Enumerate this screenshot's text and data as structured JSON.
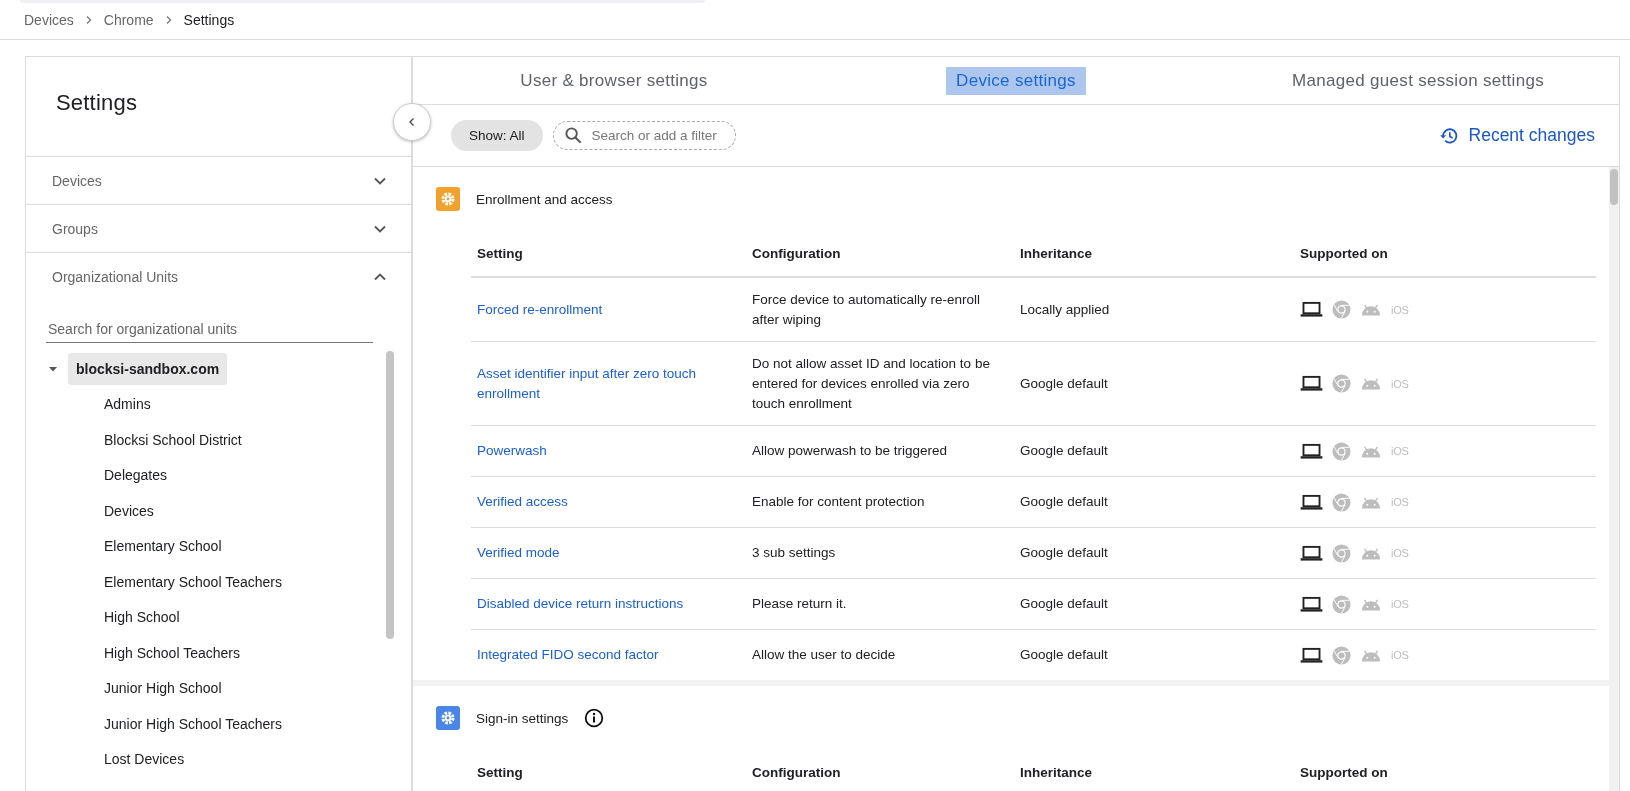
{
  "breadcrumb": [
    {
      "label": "Devices",
      "current": false
    },
    {
      "label": "Chrome",
      "current": false
    },
    {
      "label": "Settings",
      "current": true
    }
  ],
  "sidebar": {
    "title": "Settings",
    "sections": [
      {
        "label": "Devices",
        "expanded": false
      },
      {
        "label": "Groups",
        "expanded": false
      },
      {
        "label": "Organizational Units",
        "expanded": true
      }
    ],
    "search": {
      "placeholder": "Search for organizational units"
    },
    "tree": [
      {
        "label": "blocksi-sandbox.com",
        "selected": true,
        "expanded": true,
        "children": [
          {
            "label": "Admins",
            "selected": false
          },
          {
            "label": "Blocksi School District",
            "selected": false
          },
          {
            "label": "Delegates",
            "selected": false
          },
          {
            "label": "Devices",
            "selected": false
          },
          {
            "label": "Elementary School",
            "selected": false
          },
          {
            "label": "Elementary School Teachers",
            "selected": false
          },
          {
            "label": "High School",
            "selected": false
          },
          {
            "label": "High School Teachers",
            "selected": false
          },
          {
            "label": "Junior High School",
            "selected": false
          },
          {
            "label": "Junior High School Teachers",
            "selected": false
          },
          {
            "label": "Lost Devices",
            "selected": false
          }
        ]
      }
    ]
  },
  "tabs": [
    {
      "label": "User & browser settings",
      "selected": false
    },
    {
      "label": "Device settings",
      "selected": true
    },
    {
      "label": "Managed guest session settings",
      "selected": false
    }
  ],
  "toolbar": {
    "show_filter": "Show: All",
    "search": {
      "placeholder": "Search or add a filter"
    },
    "recent_changes": "Recent changes"
  },
  "sections": [
    {
      "title": "Enrollment and access",
      "color": "#f2a12e",
      "columns": [
        "Setting",
        "Configuration",
        "Inheritance",
        "Supported on"
      ],
      "rows": [
        {
          "setting": "Forced re-enrollment",
          "configuration": "Force device to automatically re-enroll after wiping",
          "inheritance": "Locally applied",
          "platforms": [
            {
              "kind": "laptop",
              "supported": true
            },
            {
              "kind": "chrome",
              "supported": false
            },
            {
              "kind": "android",
              "supported": false
            },
            {
              "kind": "ios",
              "label": "iOS",
              "supported": false
            }
          ]
        },
        {
          "setting": "Asset identifier input after zero touch enrollment",
          "configuration": "Do not allow asset ID and location to be entered for devices enrolled via zero touch enrollment",
          "inheritance": "Google default",
          "platforms": [
            {
              "kind": "laptop",
              "supported": true
            },
            {
              "kind": "chrome",
              "supported": false
            },
            {
              "kind": "android",
              "supported": false
            },
            {
              "kind": "ios",
              "label": "iOS",
              "supported": false
            }
          ]
        },
        {
          "setting": "Powerwash",
          "configuration": "Allow powerwash to be triggered",
          "inheritance": "Google default",
          "platforms": [
            {
              "kind": "laptop",
              "supported": true
            },
            {
              "kind": "chrome",
              "supported": false
            },
            {
              "kind": "android",
              "supported": false
            },
            {
              "kind": "ios",
              "label": "iOS",
              "supported": false
            }
          ]
        },
        {
          "setting": "Verified access",
          "configuration": "Enable for content protection",
          "inheritance": "Google default",
          "platforms": [
            {
              "kind": "laptop",
              "supported": true
            },
            {
              "kind": "chrome",
              "supported": false
            },
            {
              "kind": "android",
              "supported": false
            },
            {
              "kind": "ios",
              "label": "iOS",
              "supported": false
            }
          ]
        },
        {
          "setting": "Verified mode",
          "configuration": "3 sub settings",
          "inheritance": "Google default",
          "platforms": [
            {
              "kind": "laptop",
              "supported": true
            },
            {
              "kind": "chrome",
              "supported": false
            },
            {
              "kind": "android",
              "supported": false
            },
            {
              "kind": "ios",
              "label": "iOS",
              "supported": false
            }
          ]
        },
        {
          "setting": "Disabled device return instructions",
          "configuration": "Please return it.",
          "inheritance": "Google default",
          "platforms": [
            {
              "kind": "laptop",
              "supported": true
            },
            {
              "kind": "chrome",
              "supported": false
            },
            {
              "kind": "android",
              "supported": false
            },
            {
              "kind": "ios",
              "label": "iOS",
              "supported": false
            }
          ]
        },
        {
          "setting": "Integrated FIDO second factor",
          "configuration": "Allow the user to decide",
          "inheritance": "Google default",
          "platforms": [
            {
              "kind": "laptop",
              "supported": true
            },
            {
              "kind": "chrome",
              "supported": false
            },
            {
              "kind": "android",
              "supported": false
            },
            {
              "kind": "ios",
              "label": "iOS",
              "supported": false
            }
          ]
        }
      ]
    },
    {
      "title": "Sign-in settings",
      "color": "#4a86e8",
      "info": true,
      "columns": [
        "Setting",
        "Configuration",
        "Inheritance",
        "Supported on"
      ]
    }
  ]
}
